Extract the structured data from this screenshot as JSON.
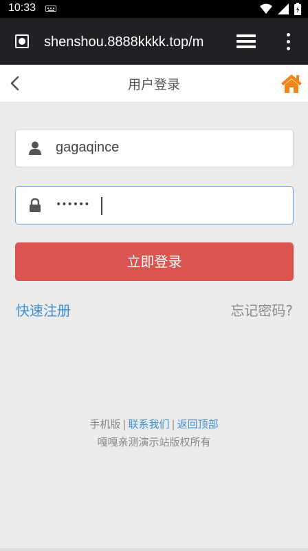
{
  "status": {
    "time": "10:33"
  },
  "browser": {
    "url": "shenshou.8888kkkk.top/m",
    "icons": [
      "site-globe-icon",
      "tabs-icon",
      "more-vert-icon"
    ]
  },
  "header": {
    "title": "用户登录",
    "back_icon": "chevron-left-icon",
    "home_icon": "home-icon",
    "home_color": "#f08519"
  },
  "form": {
    "username": {
      "value": "gagaqince",
      "icon": "user-icon"
    },
    "password": {
      "value": "••••••",
      "icon": "lock-icon"
    },
    "login_label": "立即登录",
    "login_color": "#d9534f"
  },
  "links": {
    "register": "快速注册",
    "forgot": "忘记密码?"
  },
  "footer": {
    "mobile": "手机版",
    "separator": "|",
    "contact": "联系我们",
    "top": "返回顶部",
    "copyright": "嘎嘎亲测演示站版权所有"
  }
}
